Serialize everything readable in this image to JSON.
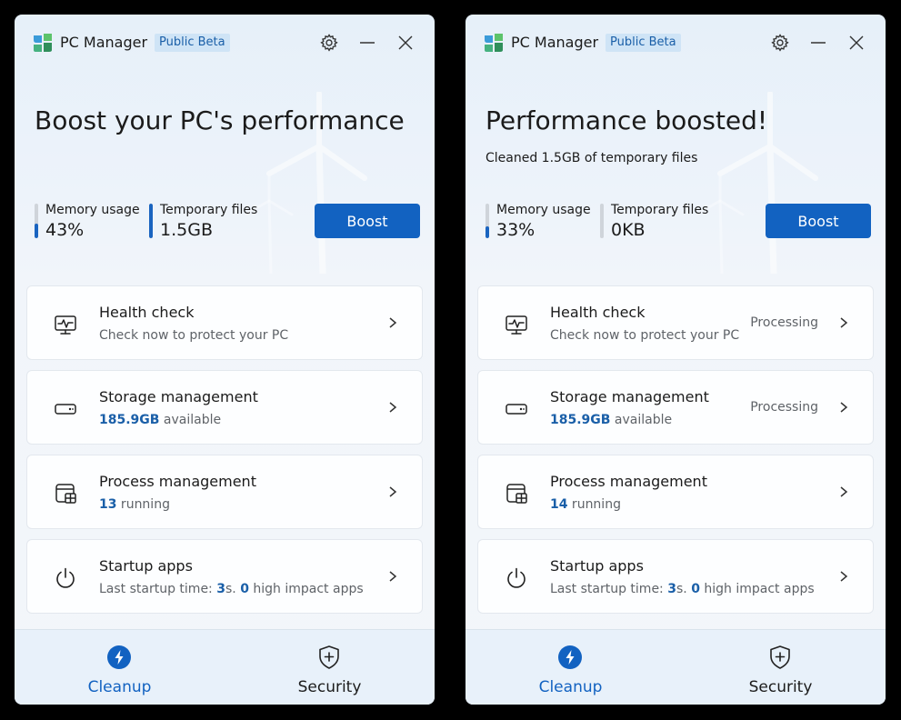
{
  "windows": [
    {
      "app_title": "PC Manager",
      "badge": "Public Beta",
      "headline": "Boost your PC's performance",
      "subline": "",
      "memory": {
        "label": "Memory usage",
        "value": "43%",
        "percent": 43
      },
      "temp": {
        "label": "Temporary files",
        "value": "1.5GB",
        "percent": 100
      },
      "boost_label": "Boost",
      "cards": {
        "health": {
          "title": "Health check",
          "sub": "Check now to protect your PC",
          "status": ""
        },
        "storage": {
          "title": "Storage management",
          "amount": "185.9GB",
          "sub_rest": " available",
          "status": ""
        },
        "process": {
          "title": "Process management",
          "count": "13",
          "sub_rest": " running",
          "status": ""
        },
        "startup": {
          "title": "Startup apps",
          "prefix": "Last startup time: ",
          "seconds": "3",
          "mid": "s. ",
          "high": "0",
          "suffix": " high impact apps",
          "status": ""
        }
      },
      "nav": {
        "cleanup": "Cleanup",
        "security": "Security"
      }
    },
    {
      "app_title": "PC Manager",
      "badge": "Public Beta",
      "headline": "Performance boosted!",
      "subline": "Cleaned 1.5GB of temporary files",
      "memory": {
        "label": "Memory usage",
        "value": "33%",
        "percent": 33
      },
      "temp": {
        "label": "Temporary files",
        "value": "0KB",
        "percent": 0
      },
      "boost_label": "Boost",
      "cards": {
        "health": {
          "title": "Health check",
          "sub": "Check now to protect your PC",
          "status": "Processing"
        },
        "storage": {
          "title": "Storage management",
          "amount": "185.9GB",
          "sub_rest": " available",
          "status": "Processing"
        },
        "process": {
          "title": "Process management",
          "count": "14",
          "sub_rest": " running",
          "status": ""
        },
        "startup": {
          "title": "Startup apps",
          "prefix": "Last startup time: ",
          "seconds": "3",
          "mid": "s. ",
          "high": "0",
          "suffix": " high impact apps",
          "status": ""
        }
      },
      "nav": {
        "cleanup": "Cleanup",
        "security": "Security"
      }
    }
  ],
  "colors": {
    "accent": "#1262c1",
    "highlight": "#1a5fa8",
    "bar_track": "#cfd4da"
  },
  "icons": {
    "logo": "pc-manager-logo",
    "settings": "gear-icon",
    "minimize": "minimize-icon",
    "close": "close-icon",
    "health": "health-monitor-icon",
    "storage": "storage-drive-icon",
    "process": "process-window-icon",
    "startup": "power-icon",
    "chevron": "chevron-right-icon",
    "cleanup": "lightning-icon",
    "security": "shield-plus-icon"
  }
}
